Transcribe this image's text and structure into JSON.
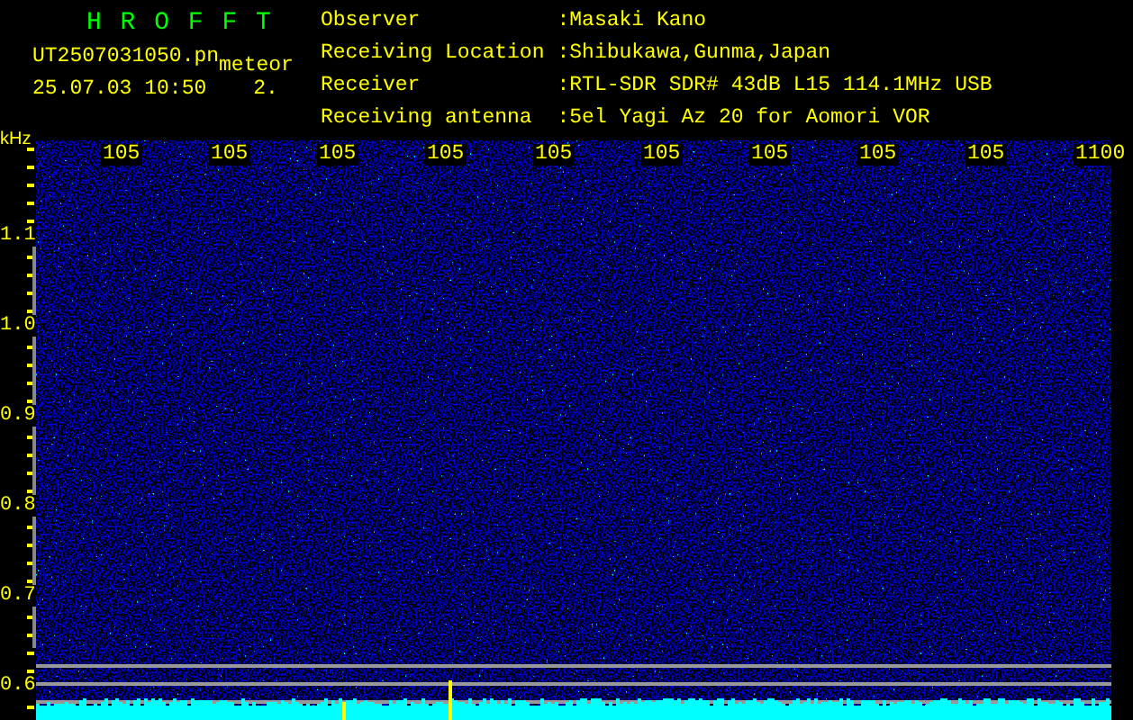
{
  "header": {
    "title": "H R O F F T",
    "file_name": "UT2507031050.pn",
    "tag": "meteor",
    "timestamp": "25.07.03 10:50",
    "count": "2."
  },
  "info": [
    {
      "label": "Observer",
      "value": ":Masaki Kano"
    },
    {
      "label": "Receiving Location",
      "value": ":Shibukawa,Gunma,Japan"
    },
    {
      "label": "Receiver",
      "value": ":RTL-SDR SDR# 43dB L15 114.1MHz USB"
    },
    {
      "label": "Receiving antenna",
      "value": ":5el Yagi Az 20 for Aomori VOR"
    }
  ],
  "spectrogram": {
    "y_unit": "kHz",
    "x_labels": [
      "105",
      "105",
      "105",
      "105",
      "105",
      "105",
      "105",
      "105",
      "105",
      "1100"
    ],
    "y_labels": [
      "1.1",
      "1.0",
      "0.9",
      "0.8",
      "0.7",
      "0.6"
    ]
  }
}
